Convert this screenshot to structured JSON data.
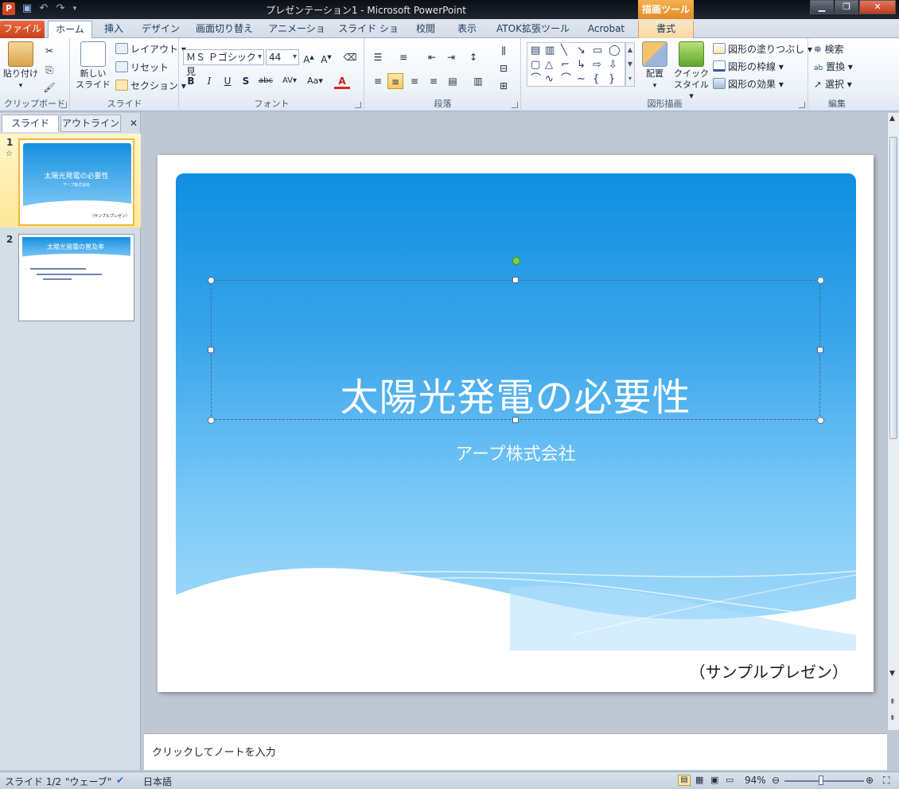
{
  "window": {
    "title": "プレゼンテーション1 - Microsoft PowerPoint",
    "app_letter": "P",
    "context_tools": "描画ツール"
  },
  "tabs": [
    {
      "label": "ファイル"
    },
    {
      "label": "ホーム"
    },
    {
      "label": "挿入"
    },
    {
      "label": "デザイン"
    },
    {
      "label": "画面切り替え"
    },
    {
      "label": "アニメーション"
    },
    {
      "label": "スライド ショー"
    },
    {
      "label": "校閲"
    },
    {
      "label": "表示"
    },
    {
      "label": "ATOK拡張ツール"
    },
    {
      "label": "Acrobat"
    },
    {
      "label": "書式"
    }
  ],
  "ribbon": {
    "clipboard": {
      "label": "クリップボード",
      "paste": "貼り付け"
    },
    "slides": {
      "label": "スライド",
      "new_slide_1": "新しい",
      "new_slide_2": "スライド",
      "layout": "レイアウト",
      "reset": "リセット",
      "section": "セクション"
    },
    "font": {
      "label": "フォント",
      "font_name": "ＭＳ Ｐゴシック 見",
      "font_size": "44"
    },
    "paragraph": {
      "label": "段落"
    },
    "drawing": {
      "label": "図形描画",
      "arrange": "配置",
      "quick_1": "クイック",
      "quick_2": "スタイル",
      "fill": "図形の塗りつぶし",
      "outline": "図形の枠線",
      "effects": "図形の効果"
    },
    "editing": {
      "label": "編集",
      "find": "検索",
      "replace": "置換",
      "select": "選択"
    }
  },
  "pane": {
    "tab_slides": "スライド",
    "tab_outline": "アウトライン",
    "thumbnails": [
      {
        "num": "1",
        "title": "太陽光発電の必要性",
        "subtitle": "アープ株式会社",
        "footer": "（サンプルプレゼン）"
      },
      {
        "num": "2",
        "title": "太陽光発電の普及率"
      }
    ]
  },
  "slide": {
    "title": "太陽光発電の必要性",
    "subtitle": "アープ株式会社",
    "footer": "（サンプルプレゼン）"
  },
  "notes": {
    "placeholder": "クリックしてノートを入力"
  },
  "status": {
    "slide_count": "スライド 1/2",
    "theme": "\"ウェーブ\"",
    "language": "日本語",
    "zoom": "94%"
  },
  "colors": {
    "file_tab": "#d24726",
    "context_tab": "#e48a24",
    "slide_gradient_top": "#0f8ee1",
    "slide_gradient_bottom": "#a9dcfa"
  }
}
